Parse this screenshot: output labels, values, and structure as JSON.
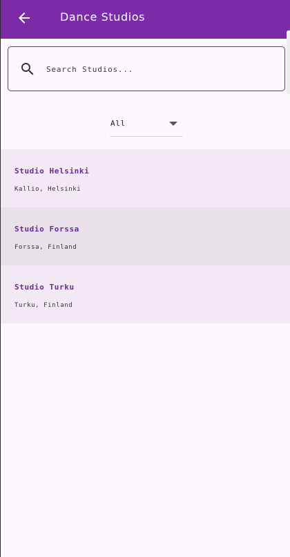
{
  "app_bar": {
    "title": "Dance Studios",
    "back_icon": "arrow-back-icon",
    "color": "#7b2aa8"
  },
  "search": {
    "placeholder": "Search Studios...",
    "value": "",
    "icon": "search-icon"
  },
  "filter": {
    "selected": "All",
    "icon": "dropdown-arrow-icon"
  },
  "studios": [
    {
      "name": "Studio Helsinki",
      "location": "Kallio, Helsinki"
    },
    {
      "name": "Studio Forssa",
      "location": "Forssa, Finland"
    },
    {
      "name": "Studio Turku",
      "location": "Turku, Finland"
    }
  ],
  "colors": {
    "accent": "#7b2aa8",
    "studio_name": "#6a2a93",
    "background": "#fdf7fe",
    "list_item": "#f2e9f4",
    "list_item_selected": "#e9e1ea"
  }
}
